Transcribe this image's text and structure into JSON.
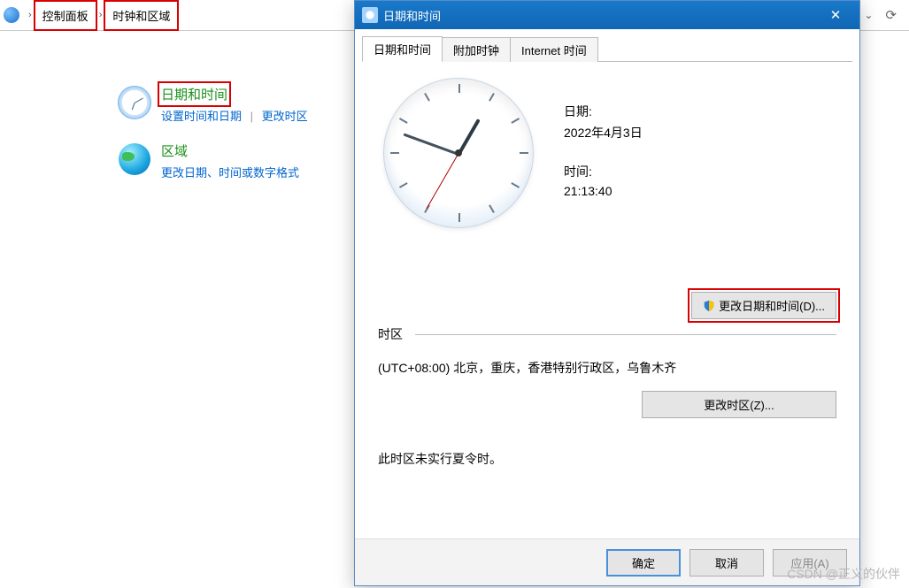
{
  "breadcrumb": {
    "item1": "控制面板",
    "item2": "时钟和区域"
  },
  "panel": {
    "datetime": {
      "title": "日期和时间",
      "link1": "设置时间和日期",
      "link2": "更改时区"
    },
    "region": {
      "title": "区域",
      "link1": "更改日期、时间或数字格式"
    }
  },
  "dialog": {
    "title": "日期和时间",
    "tabs": {
      "t1": "日期和时间",
      "t2": "附加时钟",
      "t3": "Internet 时间"
    },
    "date_label": "日期:",
    "date_value": "2022年4月3日",
    "time_label": "时间:",
    "time_value": "21:13:40",
    "change_datetime_btn": "更改日期和时间(D)...",
    "timezone_header": "时区",
    "timezone_value": "(UTC+08:00) 北京，重庆，香港特别行政区，乌鲁木齐",
    "change_timezone_btn": "更改时区(Z)...",
    "dst_note": "此时区未实行夏令时。",
    "ok": "确定",
    "cancel": "取消",
    "apply": "应用(A)"
  },
  "watermark": "CSDN @正义的伙伴"
}
